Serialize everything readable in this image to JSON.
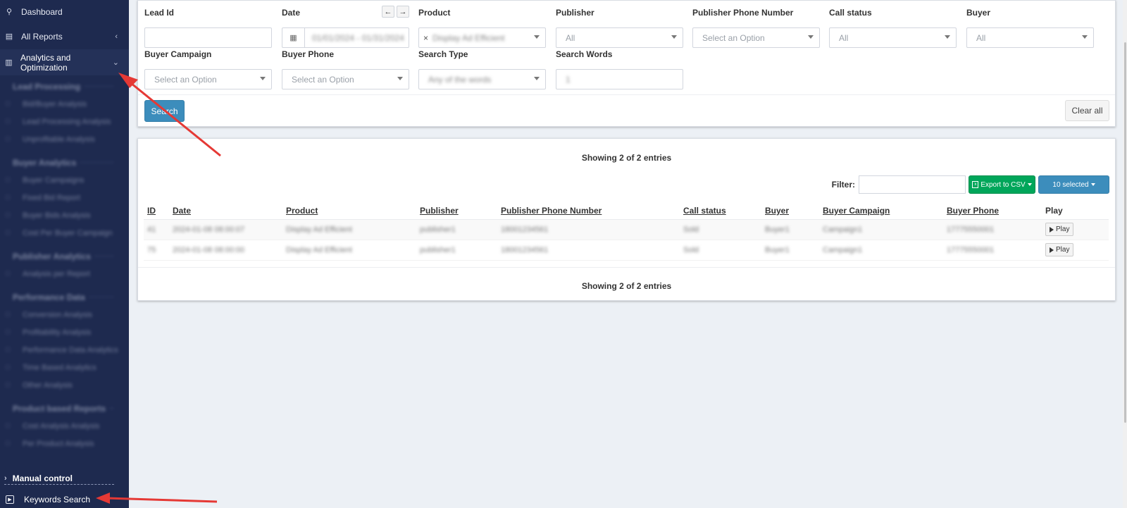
{
  "sidebar": {
    "items": [
      {
        "label": "Dashboard",
        "icon": "dashboard-icon"
      },
      {
        "label": "All Reports",
        "icon": "reports-icon"
      },
      {
        "label": "Analytics and Optimization",
        "icon": "bar-chart-icon"
      }
    ],
    "blurred_sections": [
      {
        "heading": "Lead Processing",
        "items": [
          "Bid/Buyer Analysis",
          "Lead Processing Analysis",
          "Unprofitable Analysis"
        ]
      },
      {
        "heading": "Buyer Analytics",
        "items": [
          "Buyer Campaigns",
          "Fixed Bid Report",
          "Buyer Bids Analysis",
          "Cost Per Buyer Campaign"
        ]
      },
      {
        "heading": "Publisher Analytics",
        "items": [
          "Analysis per Report"
        ]
      },
      {
        "heading": "Performance Data",
        "items": [
          "Conversion Analysis",
          "Profitability Analysis",
          "Performance Data Analytics",
          "Time Based Analytics",
          "Other Analysis"
        ]
      },
      {
        "heading": "Product based Reports",
        "items": [
          "Cost Analysis Analysis",
          "Per Product Analysis"
        ]
      }
    ],
    "manual_control": "Manual control",
    "keywords_search": "Keywords Search"
  },
  "filters": {
    "lead_id": {
      "label": "Lead Id",
      "value": ""
    },
    "date": {
      "label": "Date",
      "value": "01/01/2024 - 01/31/2024"
    },
    "product": {
      "label": "Product",
      "value": "Display Ad Efficient"
    },
    "publisher": {
      "label": "Publisher",
      "value": "All"
    },
    "publisher_phone": {
      "label": "Publisher Phone Number",
      "placeholder": "Select an Option"
    },
    "call_status": {
      "label": "Call status",
      "value": "All"
    },
    "buyer": {
      "label": "Buyer",
      "value": "All"
    },
    "buyer_campaign": {
      "label": "Buyer Campaign",
      "placeholder": "Select an Option"
    },
    "buyer_phone": {
      "label": "Buyer Phone",
      "placeholder": "Select an Option"
    },
    "search_type": {
      "label": "Search Type",
      "value": "Any of the words"
    },
    "search_words": {
      "label": "Search Words",
      "value": "1"
    },
    "search_button": "Search",
    "clear_button": "Clear all"
  },
  "results": {
    "showing_top": "Showing 2 of 2 entries",
    "showing_bottom": "Showing 2 of 2 entries",
    "filter_label": "Filter:",
    "export_label": "Export to CSV",
    "selected_label": "10 selected",
    "columns": [
      "ID",
      "Date",
      "Product",
      "Publisher",
      "Publisher Phone Number",
      "Call status",
      "Buyer",
      "Buyer Campaign",
      "Buyer Phone",
      "Play"
    ],
    "rows": [
      {
        "id": "41",
        "date": "2024-01-08 08:00:07",
        "product": "Display Ad Efficient",
        "publisher": "publisher1",
        "pub_phone": "18001234561",
        "status": "Sold",
        "buyer": "Buyer1",
        "campaign": "Campaign1",
        "buyer_phone": "17775550001",
        "play": "Play"
      },
      {
        "id": "75",
        "date": "2024-01-08 08:00:00",
        "product": "Display Ad Efficient",
        "publisher": "publisher1",
        "pub_phone": "18001234561",
        "status": "Sold",
        "buyer": "Buyer1",
        "campaign": "Campaign1",
        "buyer_phone": "17775550001",
        "play": "Play"
      }
    ]
  },
  "colors": {
    "sidebar_bg": "#1e2a4f",
    "primary": "#3c8dbc",
    "success": "#00a65a",
    "annotation_arrow": "#e53935"
  }
}
